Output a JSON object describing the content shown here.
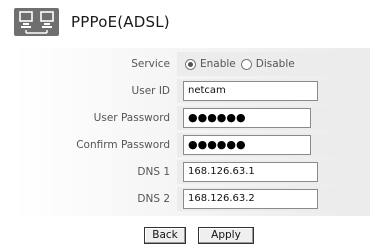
{
  "header": {
    "title": "PPPoE(ADSL)",
    "icon": "network-computers-icon"
  },
  "form": {
    "service": {
      "label": "Service",
      "options": [
        "Enable",
        "Disable"
      ],
      "selected": "Enable"
    },
    "user_id": {
      "label": "User ID",
      "value": "netcam"
    },
    "user_password": {
      "label": "User Password",
      "masked_value": "●●●●●●"
    },
    "confirm_password": {
      "label": "Confirm Password",
      "masked_value": "●●●●●●"
    },
    "dns1": {
      "label": "DNS 1",
      "value": "168.126.63.1"
    },
    "dns2": {
      "label": "DNS 2",
      "value": "168.126.63.2"
    }
  },
  "actions": {
    "back_label": "Back",
    "apply_label": "Apply"
  }
}
